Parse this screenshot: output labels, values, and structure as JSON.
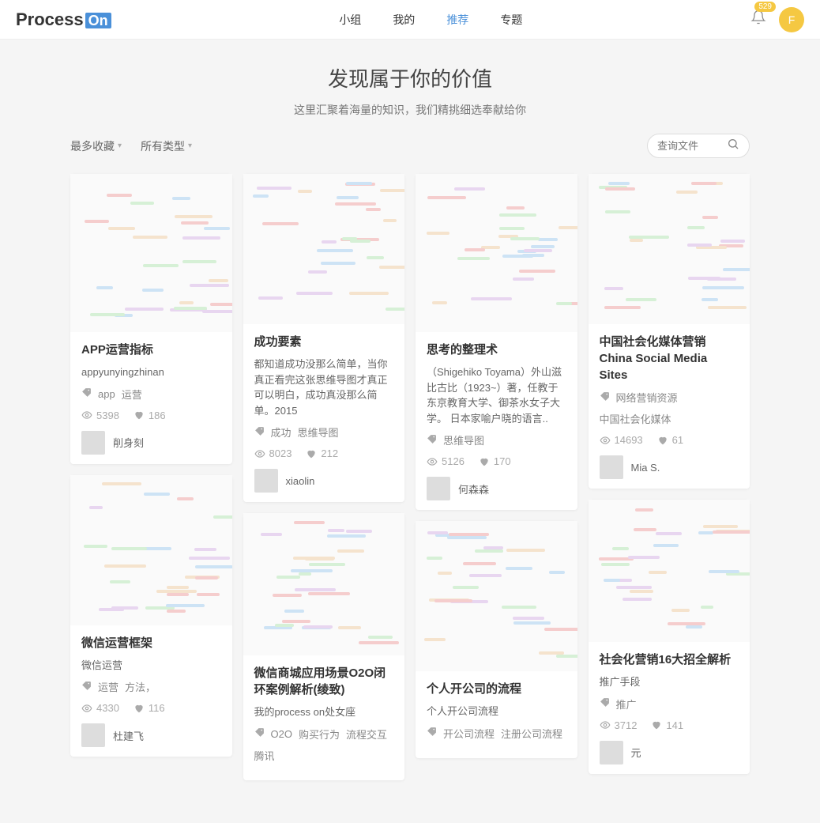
{
  "header": {
    "logo_main": "Process",
    "logo_suffix": "On",
    "nav": [
      {
        "label": "小组",
        "active": false
      },
      {
        "label": "我的",
        "active": false
      },
      {
        "label": "推荐",
        "active": true
      },
      {
        "label": "专题",
        "active": false
      }
    ],
    "badge": "529",
    "avatar_letter": "F"
  },
  "hero": {
    "title": "发现属于你的价值",
    "subtitle": "这里汇聚着海量的知识，我们精挑细选奉献给你"
  },
  "filters": {
    "sort": "最多收藏",
    "type": "所有类型"
  },
  "search": {
    "placeholder": "查询文件"
  },
  "cards": [
    {
      "title": "APP运营指标",
      "desc": "appyunyingzhinan",
      "tags": [
        "app",
        "运营"
      ],
      "views": "5398",
      "likes": "186",
      "author": "削身刻",
      "thumb_h": 200
    },
    {
      "title": "微信运营框架",
      "desc": "微信运营",
      "tags": [
        "运营",
        "方法，"
      ],
      "views": "4330",
      "likes": "116",
      "author": "杜建飞",
      "thumb_h": 190
    },
    {
      "title": "成功要素",
      "desc": "都知道成功没那么简单，当你真正看完这张思维导图才真正可以明白，成功真没那么简单。2015",
      "tags": [
        "成功",
        "思维导图"
      ],
      "views": "8023",
      "likes": "212",
      "author": "xiaolin",
      "thumb_h": 190
    },
    {
      "title": "微信商城应用场景O2O闭环案例解析(绫致)",
      "desc": "我的process on处女座",
      "tags": [
        "O2O",
        "购买行为",
        "流程交互",
        "腾讯"
      ],
      "views": "",
      "likes": "",
      "author": "",
      "thumb_h": 180
    },
    {
      "title": "思考的整理术",
      "desc": "（Shigehiko Toyama）外山滋比古比（1923~）著，任教于东京教育大学、御茶水女子大学。 日本家喻户晓的语言..",
      "tags": [
        "思维导图"
      ],
      "views": "5126",
      "likes": "170",
      "author": "何森森",
      "thumb_h": 200
    },
    {
      "title": "个人开公司的流程",
      "desc": "个人开公司流程",
      "tags": [
        "开公司流程",
        "注册公司流程"
      ],
      "views": "",
      "likes": "",
      "author": "",
      "thumb_h": 190
    },
    {
      "title": "中国社会化媒体营销China Social Media Sites",
      "desc": "",
      "tags": [
        "网络营销资源",
        "中国社会化媒体"
      ],
      "views": "14693",
      "likes": "61",
      "author": "Mia S.",
      "thumb_h": 190
    },
    {
      "title": "社会化营销16大招全解析",
      "desc": "推广手段",
      "tags": [
        "推广"
      ],
      "views": "3712",
      "likes": "141",
      "author": "元",
      "thumb_h": 180
    }
  ]
}
